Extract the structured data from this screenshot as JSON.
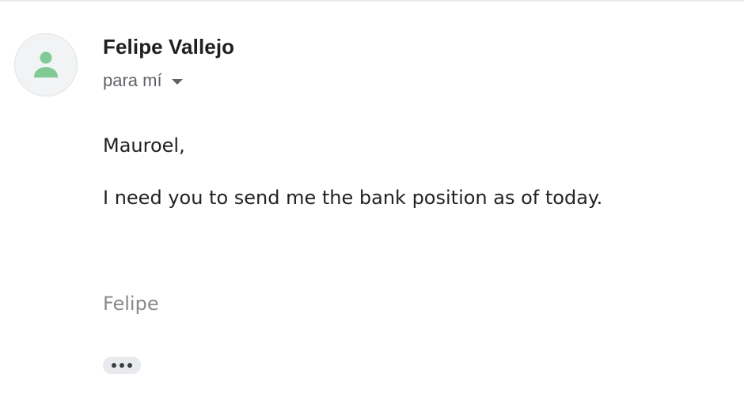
{
  "email": {
    "sender_name": "Felipe Vallejo",
    "recipient_label": "para mí",
    "body": {
      "greeting": "Mauroel,",
      "message": "I need you to send me the bank position as of today.",
      "signature": "Felipe"
    }
  },
  "icons": {
    "avatar": "person-icon",
    "recipient_toggle": "chevron-down-icon",
    "trimmed_content": "more-horiz-icon"
  },
  "colors": {
    "avatar_person": "#81c995",
    "avatar_background": "#f1f3f4",
    "secondary_text": "#5f6368",
    "signature_text": "#888888"
  }
}
